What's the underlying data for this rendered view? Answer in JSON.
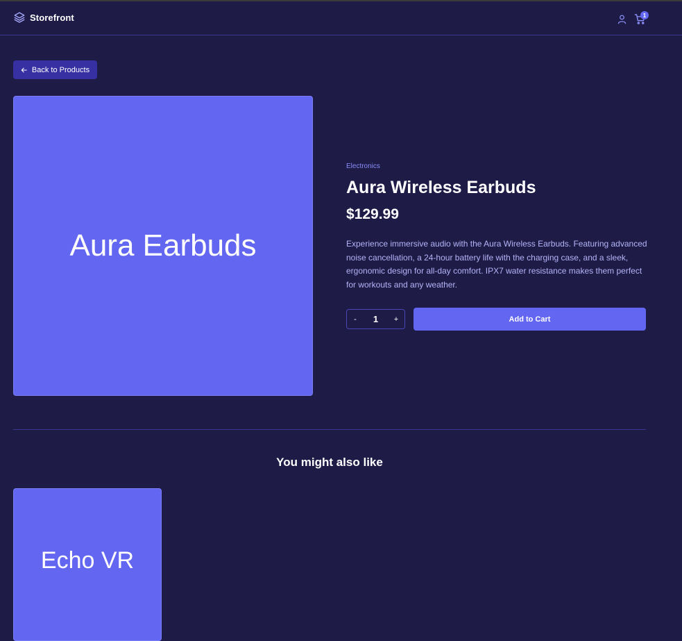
{
  "header": {
    "brand": "Storefront",
    "brand_icon": "layers-icon",
    "user_icon": "user-icon",
    "cart_icon": "cart-icon",
    "cart_count": "1"
  },
  "nav": {
    "back_label": "Back to Products",
    "back_icon": "arrow-left-icon"
  },
  "product": {
    "image_text": "Aura Earbuds",
    "category": "Electronics",
    "name": "Aura Wireless Earbuds",
    "price": "$129.99",
    "description": "Experience immersive audio with the Aura Wireless Earbuds. Featuring advanced noise cancellation, a 24-hour battery life with the charging case, and a sleek, ergonomic design for all-day comfort. IPX7 water resistance makes them perfect for workouts and any weather.",
    "quantity": "1",
    "decrement_label": "-",
    "increment_label": "+",
    "add_to_cart_label": "Add to Cart"
  },
  "related": {
    "heading": "You might also like",
    "items": [
      {
        "image_text": "Echo VR"
      }
    ]
  },
  "colors": {
    "background": "#1e1b47",
    "accent": "#6366f1",
    "back_button": "#3730a3",
    "muted_text": "#b4b4f7"
  }
}
